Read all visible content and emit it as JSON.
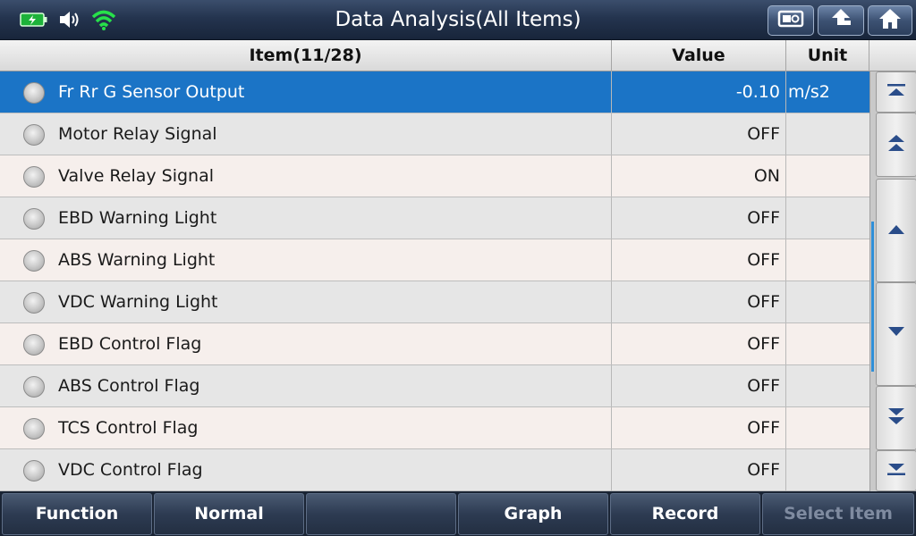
{
  "header": {
    "title": "Data Analysis(All Items)",
    "status_icons": [
      "battery-charging-icon",
      "speaker-icon",
      "wifi-icon"
    ],
    "buttons": [
      "screenshot-icon",
      "back-up-arrow-icon",
      "home-icon"
    ]
  },
  "table": {
    "columns": {
      "item": "Item(11/28)",
      "value": "Value",
      "unit": "Unit"
    },
    "rows": [
      {
        "item": "Fr Rr G Sensor Output",
        "value": "-0.10",
        "unit": "m/s2",
        "selected": true
      },
      {
        "item": "Motor Relay Signal",
        "value": "OFF",
        "unit": ""
      },
      {
        "item": "Valve Relay Signal",
        "value": "ON",
        "unit": ""
      },
      {
        "item": "EBD Warning Light",
        "value": "OFF",
        "unit": ""
      },
      {
        "item": "ABS Warning Light",
        "value": "OFF",
        "unit": ""
      },
      {
        "item": "VDC Warning Light",
        "value": "OFF",
        "unit": ""
      },
      {
        "item": "EBD Control Flag",
        "value": "OFF",
        "unit": ""
      },
      {
        "item": "ABS Control Flag",
        "value": "OFF",
        "unit": ""
      },
      {
        "item": "TCS Control Flag",
        "value": "OFF",
        "unit": ""
      },
      {
        "item": "VDC Control Flag",
        "value": "OFF",
        "unit": ""
      }
    ]
  },
  "scroll": {
    "buttons": [
      "scroll-top-icon",
      "page-up-icon",
      "line-up-icon",
      "line-down-icon",
      "page-down-icon",
      "scroll-bottom-icon"
    ]
  },
  "toolbar": {
    "buttons": [
      {
        "label": "Function",
        "enabled": true
      },
      {
        "label": "Normal",
        "enabled": true
      },
      {
        "label": "",
        "enabled": true
      },
      {
        "label": "Graph",
        "enabled": true
      },
      {
        "label": "Record",
        "enabled": true
      },
      {
        "label": "Select Item",
        "enabled": false
      }
    ]
  },
  "colors": {
    "selected_row": "#1b74c6",
    "row_even": "#e6e6e6",
    "row_odd": "#f6efec",
    "scroll_indicator": "#2f8fd8"
  }
}
